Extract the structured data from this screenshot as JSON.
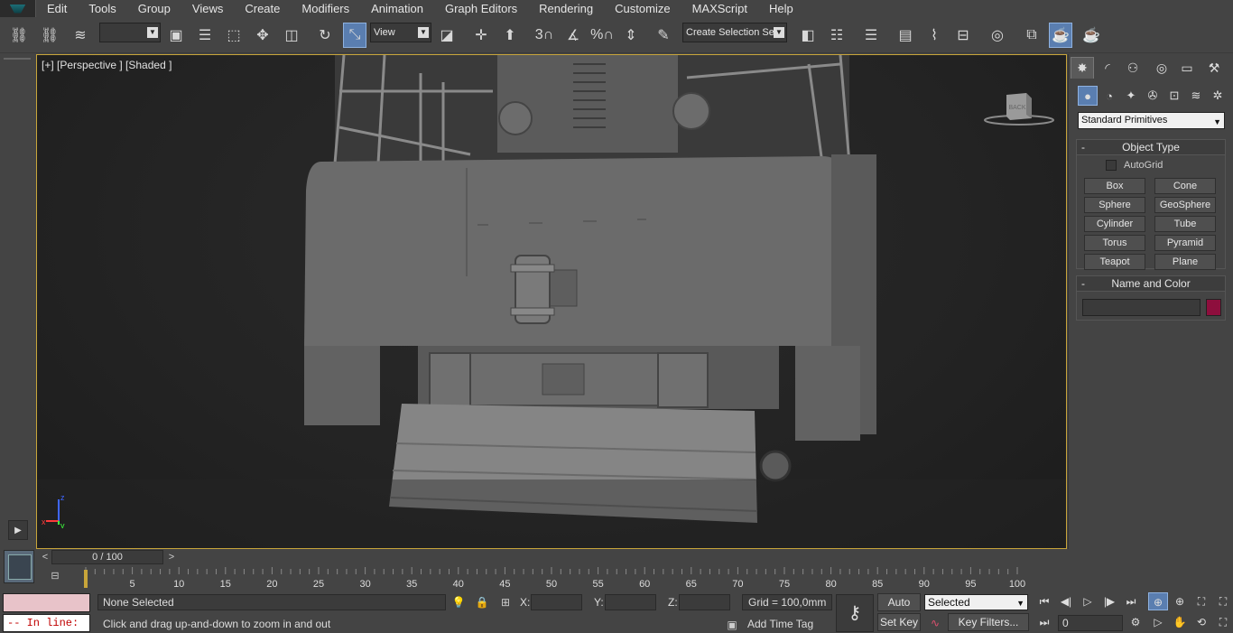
{
  "menu": [
    "Edit",
    "Tools",
    "Group",
    "Views",
    "Create",
    "Modifiers",
    "Animation",
    "Graph Editors",
    "Rendering",
    "Customize",
    "MAXScript",
    "Help"
  ],
  "toolbar": {
    "selection_filter": "",
    "ref_coord": "View",
    "named_selection": "Create Selection Se",
    "snap_3_label": "3",
    "percent_label": "%"
  },
  "viewport": {
    "label": "[+] [Perspective ] [Shaded ]",
    "viewcube_face": "BACK",
    "axis_z": "z",
    "axis_x": "x",
    "axis_y": "y"
  },
  "command_panel": {
    "primitive_type": "Standard Primitives",
    "object_type_title": "Object Type",
    "autogrid_label": "AutoGrid",
    "buttons": [
      "Box",
      "Cone",
      "Sphere",
      "GeoSphere",
      "Cylinder",
      "Tube",
      "Torus",
      "Pyramid",
      "Teapot",
      "Plane"
    ],
    "name_color_title": "Name and Color",
    "object_name": "",
    "object_color": "#8e0e3d"
  },
  "timeline": {
    "frame_display": "0 / 100",
    "prev": "<",
    "next": ">",
    "ticks": [
      "5",
      "10",
      "15",
      "20",
      "25",
      "30",
      "35",
      "40",
      "45",
      "50",
      "55",
      "60",
      "65",
      "70",
      "75",
      "80",
      "85",
      "90",
      "95",
      "100"
    ]
  },
  "status": {
    "listener_prompt": "-- In line:",
    "selection": "None Selected",
    "prompt": "Click and drag up-and-down to zoom in and out",
    "x_label": "X:",
    "y_label": "Y:",
    "z_label": "Z:",
    "x_value": "",
    "y_value": "",
    "z_value": "",
    "grid": "Grid = 100,0mm",
    "add_time_tag": "Add Time Tag",
    "auto_key": "Auto Key",
    "set_key": "Set Key",
    "key_mode": "Selected",
    "key_filters": "Key Filters...",
    "current_frame": "0"
  },
  "colors": {
    "viewport_border": "#c8a53a",
    "active_blue": "#5a7eb0",
    "listener_pink": "#e8c3c9",
    "error_red": "#c00000"
  }
}
